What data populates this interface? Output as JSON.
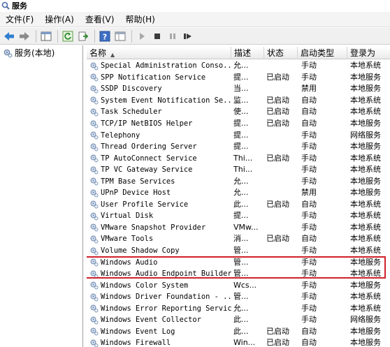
{
  "window": {
    "title": "服务"
  },
  "menu": [
    "文件(F)",
    "操作(A)",
    "查看(V)",
    "帮助(H)"
  ],
  "toolbar": [
    "back-icon",
    "forward-icon",
    "console-tree-icon",
    "refresh-icon",
    "export-list-icon",
    "help-icon",
    "properties-icon",
    "start-icon",
    "stop-icon",
    "pause-icon",
    "restart-icon"
  ],
  "tree": {
    "root_label": "服务(本地)"
  },
  "columns": {
    "name": "名称",
    "desc": "描述",
    "state": "状态",
    "start": "启动类型",
    "logon": "登录为"
  },
  "services": [
    {
      "name": "Special Administration Conso...",
      "desc": "允...",
      "state": "",
      "start": "手动",
      "logon": "本地系统"
    },
    {
      "name": "SPP Notification Service",
      "desc": "提...",
      "state": "已启动",
      "start": "手动",
      "logon": "本地服务"
    },
    {
      "name": "SSDP Discovery",
      "desc": "当...",
      "state": "",
      "start": "禁用",
      "logon": "本地服务"
    },
    {
      "name": "System Event Notification Se...",
      "desc": "监...",
      "state": "已启动",
      "start": "自动",
      "logon": "本地系统"
    },
    {
      "name": "Task Scheduler",
      "desc": "使...",
      "state": "已启动",
      "start": "自动",
      "logon": "本地系统"
    },
    {
      "name": "TCP/IP NetBIOS Helper",
      "desc": "提...",
      "state": "已启动",
      "start": "自动",
      "logon": "本地服务"
    },
    {
      "name": "Telephony",
      "desc": "提...",
      "state": "",
      "start": "手动",
      "logon": "网络服务"
    },
    {
      "name": "Thread Ordering Server",
      "desc": "提...",
      "state": "",
      "start": "手动",
      "logon": "本地服务"
    },
    {
      "name": "TP AutoConnect Service",
      "desc": "Thi...",
      "state": "已启动",
      "start": "手动",
      "logon": "本地系统"
    },
    {
      "name": "TP VC Gateway Service",
      "desc": "Thi...",
      "state": "",
      "start": "手动",
      "logon": "本地系统"
    },
    {
      "name": "TPM Base Services",
      "desc": "允...",
      "state": "",
      "start": "手动",
      "logon": "本地服务"
    },
    {
      "name": "UPnP Device Host",
      "desc": "允...",
      "state": "",
      "start": "禁用",
      "logon": "本地服务"
    },
    {
      "name": "User Profile Service",
      "desc": "此...",
      "state": "已启动",
      "start": "自动",
      "logon": "本地系统"
    },
    {
      "name": "Virtual Disk",
      "desc": "提...",
      "state": "",
      "start": "手动",
      "logon": "本地系统"
    },
    {
      "name": "VMware Snapshot Provider",
      "desc": "VMw...",
      "state": "",
      "start": "手动",
      "logon": "本地系统"
    },
    {
      "name": "VMware Tools",
      "desc": "消...",
      "state": "已启动",
      "start": "自动",
      "logon": "本地系统"
    },
    {
      "name": "Volume Shadow Copy",
      "desc": "管...",
      "state": "",
      "start": "手动",
      "logon": "本地系统"
    },
    {
      "name": "Windows Audio",
      "desc": "管...",
      "state": "",
      "start": "手动",
      "logon": "本地服务"
    },
    {
      "name": "Windows Audio Endpoint Builder",
      "desc": "管...",
      "state": "",
      "start": "手动",
      "logon": "本地系统"
    },
    {
      "name": "Windows Color System",
      "desc": "Wcs...",
      "state": "",
      "start": "手动",
      "logon": "本地服务"
    },
    {
      "name": "Windows Driver Foundation - ...",
      "desc": "管...",
      "state": "",
      "start": "手动",
      "logon": "本地系统"
    },
    {
      "name": "Windows Error Reporting Service",
      "desc": "允...",
      "state": "",
      "start": "手动",
      "logon": "本地系统"
    },
    {
      "name": "Windows Event Collector",
      "desc": "此...",
      "state": "",
      "start": "手动",
      "logon": "网络服务"
    },
    {
      "name": "Windows Event Log",
      "desc": "此...",
      "state": "已启动",
      "start": "自动",
      "logon": "本地服务"
    },
    {
      "name": "Windows Firewall",
      "desc": "Win...",
      "state": "已启动",
      "start": "自动",
      "logon": "本地服务"
    }
  ],
  "colors": {
    "highlight": "#d0202a",
    "toolbar_arrow": "#2f7fd0"
  }
}
